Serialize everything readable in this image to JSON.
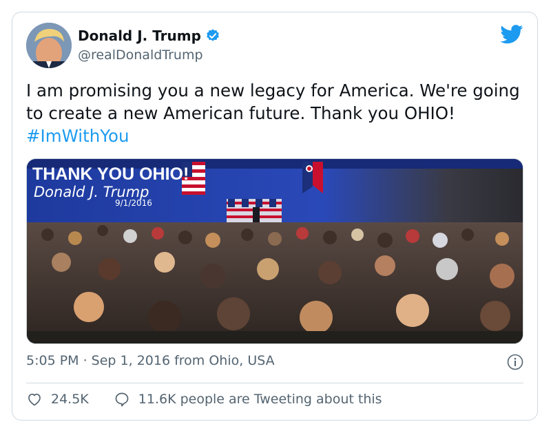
{
  "tweet": {
    "display_name": "Donald J. Trump",
    "handle": "@realDonaldTrump",
    "text_main": "I am promising you a new legacy for America. We're going to create a new American future. Thank you OHIO! ",
    "hashtag": "#ImWithYou",
    "timestamp": "5:05 PM · Sep 1, 2016 from Ohio, USA"
  },
  "media": {
    "headline": "THANK YOU OHIO!",
    "signature": "Donald J. Trump",
    "date": "9/1/2016"
  },
  "actions": {
    "likes": "24.5K",
    "retweets_text": "11.6K people are Tweeting about this"
  },
  "colors": {
    "accent": "#1d9bf0",
    "muted": "#536471",
    "border": "#cfd9de",
    "stage_blue": "#1f3fa8"
  },
  "icons": [
    "verified-badge-icon",
    "twitter-bird-icon",
    "info-icon",
    "heart-icon",
    "comment-icon"
  ]
}
